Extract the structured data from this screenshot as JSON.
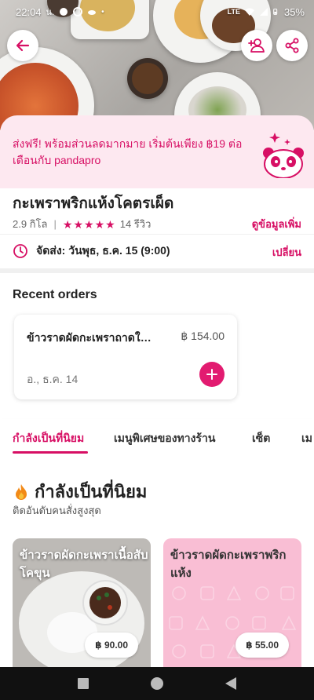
{
  "status_bar": {
    "time": "22:04",
    "extra": "น.",
    "network": "LTE",
    "battery": "35%"
  },
  "hero": {
    "back_icon": "arrow-left-icon",
    "group_order_icon": "add-person-icon",
    "share_icon": "share-icon"
  },
  "promo": {
    "text": "ส่งฟรี! พร้อมส่วนลดมากมาย เริ่มต้นเพียง ฿19 ต่อเดือนกับ pandapro",
    "icon": "pandapro-mascot-icon"
  },
  "restaurant": {
    "name": "กะเพราพริกแห้งโคตรเผ็ด",
    "distance": "2.9 กิโล",
    "rating": 5,
    "reviews": "14 รีวิว",
    "more_info": "ดูข้อมูลเพิ่ม",
    "delivery": "จัดส่ง: วันพุธ, ธ.ค. 15 (9:00)",
    "change": "เปลี่ยน"
  },
  "recent_orders": {
    "title": "Recent orders",
    "items": [
      {
        "name": "ข้าวราดผัดกะเพราถาดใหญ่",
        "price": "฿ 154.00",
        "date": "อ., ธ.ค. 14"
      }
    ]
  },
  "tabs": [
    {
      "label": "กำลังเป็นที่นิยม",
      "active": true
    },
    {
      "label": "เมนูพิเศษของทางร้าน",
      "active": false
    },
    {
      "label": "เซ็ต",
      "active": false
    },
    {
      "label": "เม",
      "active": false
    }
  ],
  "popular": {
    "title": "กำลังเป็นที่นิยม",
    "subtitle": "ติดอันดับคนสั่งสูงสุด",
    "icon": "fire-icon",
    "dishes": [
      {
        "name": "ข้าวราดผัดกะเพราเนื้อสับโคขุน",
        "price": "฿ 90.00"
      },
      {
        "name": "ข้าวราดผัดกะเพราพริกแห้ง",
        "price": "฿ 55.00"
      }
    ]
  },
  "colors": {
    "brand": "#d70f64",
    "promo_bg": "#fde8f0",
    "dish_placeholder_bg": "#f9bed4"
  }
}
